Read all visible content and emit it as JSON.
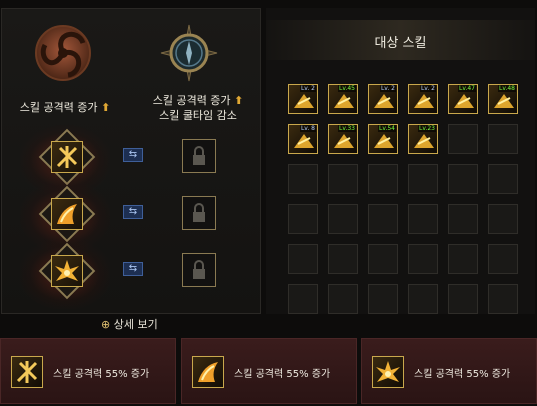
{
  "left": {
    "attack_title": "스킬 공격력 증가",
    "cooldown_title_line1": "스킬 공격력 증가",
    "cooldown_title_line2": "스킬 쿨타임 감소",
    "swap_glyph": "⇆",
    "detail_link": "상세 보기"
  },
  "right": {
    "title": "대상 스킬",
    "skills": [
      {
        "level": "Lv. 2",
        "icon": "arrow-dash-icon"
      },
      {
        "level": "Lv.45",
        "icon": "whirl-slash-icon"
      },
      {
        "level": "Lv. 2",
        "icon": "spin-figure-icon"
      },
      {
        "level": "Lv. 2",
        "icon": "strike-figure-icon"
      },
      {
        "level": "Lv.47",
        "icon": "kick-figure-icon"
      },
      {
        "level": "Lv.48",
        "icon": "vortex-icon"
      },
      {
        "level": "Lv. 8",
        "icon": "ground-spike-icon"
      },
      {
        "level": "Lv.33",
        "icon": "flame-dash-icon"
      },
      {
        "level": "Lv.54",
        "icon": "fire-burst-icon"
      },
      {
        "level": "Lv.23",
        "icon": "runner-icon"
      }
    ]
  },
  "cards": [
    {
      "text": "스킬 공격력 55% 증가",
      "icon": "crossed-blades-icon"
    },
    {
      "text": "스킬 공격력 55% 증가",
      "icon": "fire-slash-icon"
    },
    {
      "text": "스킬 공격력 55% 증가",
      "icon": "explosion-icon"
    }
  ]
}
